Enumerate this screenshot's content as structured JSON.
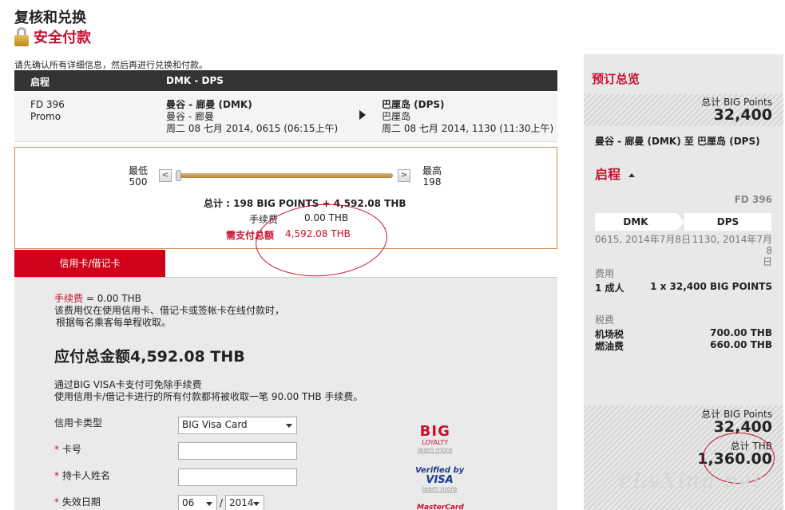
{
  "header": {
    "title": "复核和兑换",
    "subtitle": "安全付款",
    "intro": "请先确认所有详细信息，然后再进行兑换和付款。"
  },
  "trip": {
    "header_label": "启程",
    "header_route": "DMK - DPS",
    "flight_no": "FD 396",
    "fare_type": "Promo",
    "dep_city": "曼谷 - 廊曼 (DMK)",
    "dep_sub": "曼谷 - 廊曼",
    "dep_time": "周二 08 七月 2014, 0615 (06:15上午)",
    "arr_city": "巴厘岛 (DPS)",
    "arr_sub": "巴厘岛",
    "arr_time": "周二 08 七月 2014, 1130 (11:30上午)"
  },
  "slider": {
    "min_label": "最低",
    "min_value": "500",
    "max_label": "最高",
    "max_value": "198",
    "left_btn": "<",
    "right_btn": ">",
    "position": 0,
    "total_line": "总计 : 198 BIG POINTS + 4,592.08 THB",
    "fee_label": "手续费",
    "fee_value": "0.00 THB",
    "due_label": "需支付总额",
    "due_value": "4,592.08 THB"
  },
  "payment": {
    "tab_label": "信用卡/借记卡",
    "fee_label": "手续费",
    "fee_value": " = 0.00 THB",
    "fee_note1": "该费用仅在使用信用卡、借记卡或签帐卡在线付款时，",
    "fee_note2": "根据每名乘客每单程收取。",
    "amount_due": "应付总金额4,592.08 THB",
    "visa_note1": "通过BIG VISA卡支付可免除手续费",
    "visa_note2": "使用信用卡/借记卡进行的所有付款都将被收取一笔 90.00 THB 手续费。",
    "card_type_label": "信用卡类型",
    "card_type_value": "BIG Visa Card",
    "card_no_label": "卡号",
    "holder_label": "持卡人姓名",
    "expiry_label": "失效日期",
    "expiry_month": "06",
    "expiry_sep": "/",
    "expiry_year": "2014",
    "star": "*"
  },
  "logos": {
    "big": "BIG",
    "big_sub": "LOYALTY",
    "visa_top": "Verified by",
    "visa_main": "VISA",
    "mastercard": "MasterCard",
    "learn_more": "learn more"
  },
  "summary": {
    "title": "预订总览",
    "points_label": "总计 BIG Points",
    "points_value": "32,400",
    "route": "曼谷 - 廊曼 (DMK) 至 巴厘岛 (DPS)",
    "section": "启程",
    "flight_no": "FD 396",
    "from_code": "DMK",
    "to_code": "DPS",
    "from_time": "0615, 2014年7月8日",
    "to_time": "1130, 2014年7月8",
    "to_time2": "日",
    "fees_label": "费用",
    "adult_label": "1 成人",
    "adult_value": "1 x 32,400 BIG POINTS",
    "tax_label": "税费",
    "airport_tax_label": "机场税",
    "airport_tax_value": "700.00 THB",
    "fuel_label": "燃油费",
    "fuel_value": "660.00 THB",
    "total_points_label": "总计 BIG Points",
    "total_points_value": "32,400",
    "total_thb_label": "总计 THB",
    "total_thb_value": "1,360.00"
  },
  "watermark": "eLvXing.net",
  "colors": {
    "accent": "#c8102e",
    "tab": "#d0021b",
    "header_bar": "#333333"
  }
}
